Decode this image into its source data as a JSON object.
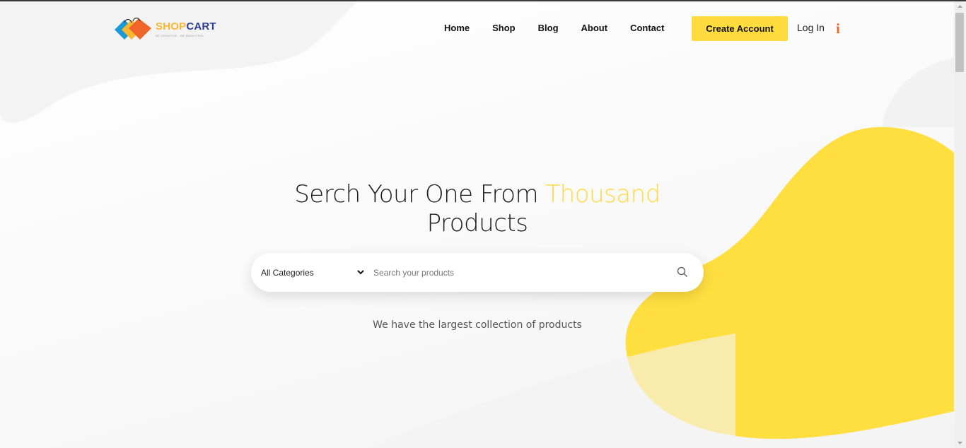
{
  "brand": {
    "name_part1": "SHOP",
    "name_part2": "CART",
    "tagline": "BE CREATIVE · BE BEAUTIFUL",
    "colors": {
      "primary_yellow": "#ffdb3e",
      "accent_orange": "#f0662a",
      "navy": "#2c3e8f"
    }
  },
  "nav": {
    "items": [
      {
        "label": "Home"
      },
      {
        "label": "Shop"
      },
      {
        "label": "Blog"
      },
      {
        "label": "About"
      },
      {
        "label": "Contact"
      }
    ],
    "create_account_label": "Create Account",
    "login_label": "Log In",
    "info_icon": "info-icon"
  },
  "hero": {
    "title_part1": "Serch Your One From ",
    "title_accent": "Thousand",
    "title_part2": "Products",
    "subtitle": "We have the largest collection of products"
  },
  "search": {
    "category_selected": "All Categories",
    "placeholder": "Search your products",
    "value": "",
    "button_icon": "search-icon"
  }
}
